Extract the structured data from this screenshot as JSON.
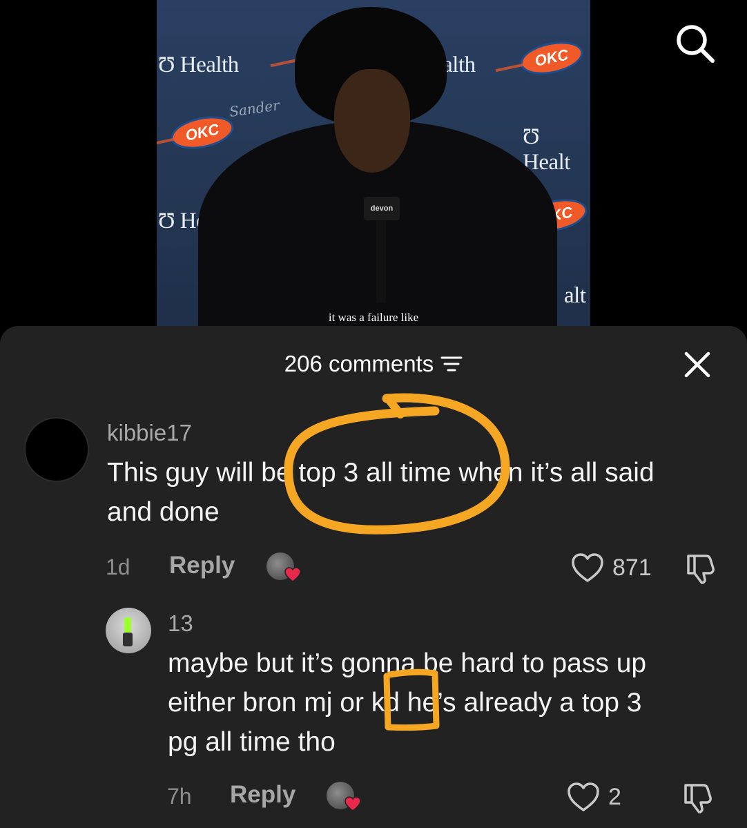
{
  "video": {
    "caption": "it was a failure like",
    "watermark": "Sander",
    "backdrop": {
      "health_label_1": "Health",
      "health_label_2": "ealth",
      "health_label_3": "Healt",
      "health_label_4": "Hea",
      "health_label_5": "alt",
      "okc_badge": "OKC",
      "mic_flag": "devon"
    }
  },
  "panel": {
    "title": "206 comments"
  },
  "comments": [
    {
      "username": "kibbie17",
      "text_line1": "This guy will be top 3 all time when it’s all said",
      "text_line2": "and done",
      "time": "1d",
      "reply_label": "Reply",
      "likes": "871"
    },
    {
      "username": "13",
      "text_line1": "maybe but it’s gonna be hard to pass up",
      "text_line2": "either bron mj or kd he’s already a top 3",
      "text_line3": "pg all time tho",
      "time": "7h",
      "reply_label": "Reply",
      "likes": "2"
    }
  ],
  "annotations": {
    "color": "#f5a623"
  },
  "colors": {
    "panel_bg": "#222222",
    "heart_red": "#e8294b"
  }
}
